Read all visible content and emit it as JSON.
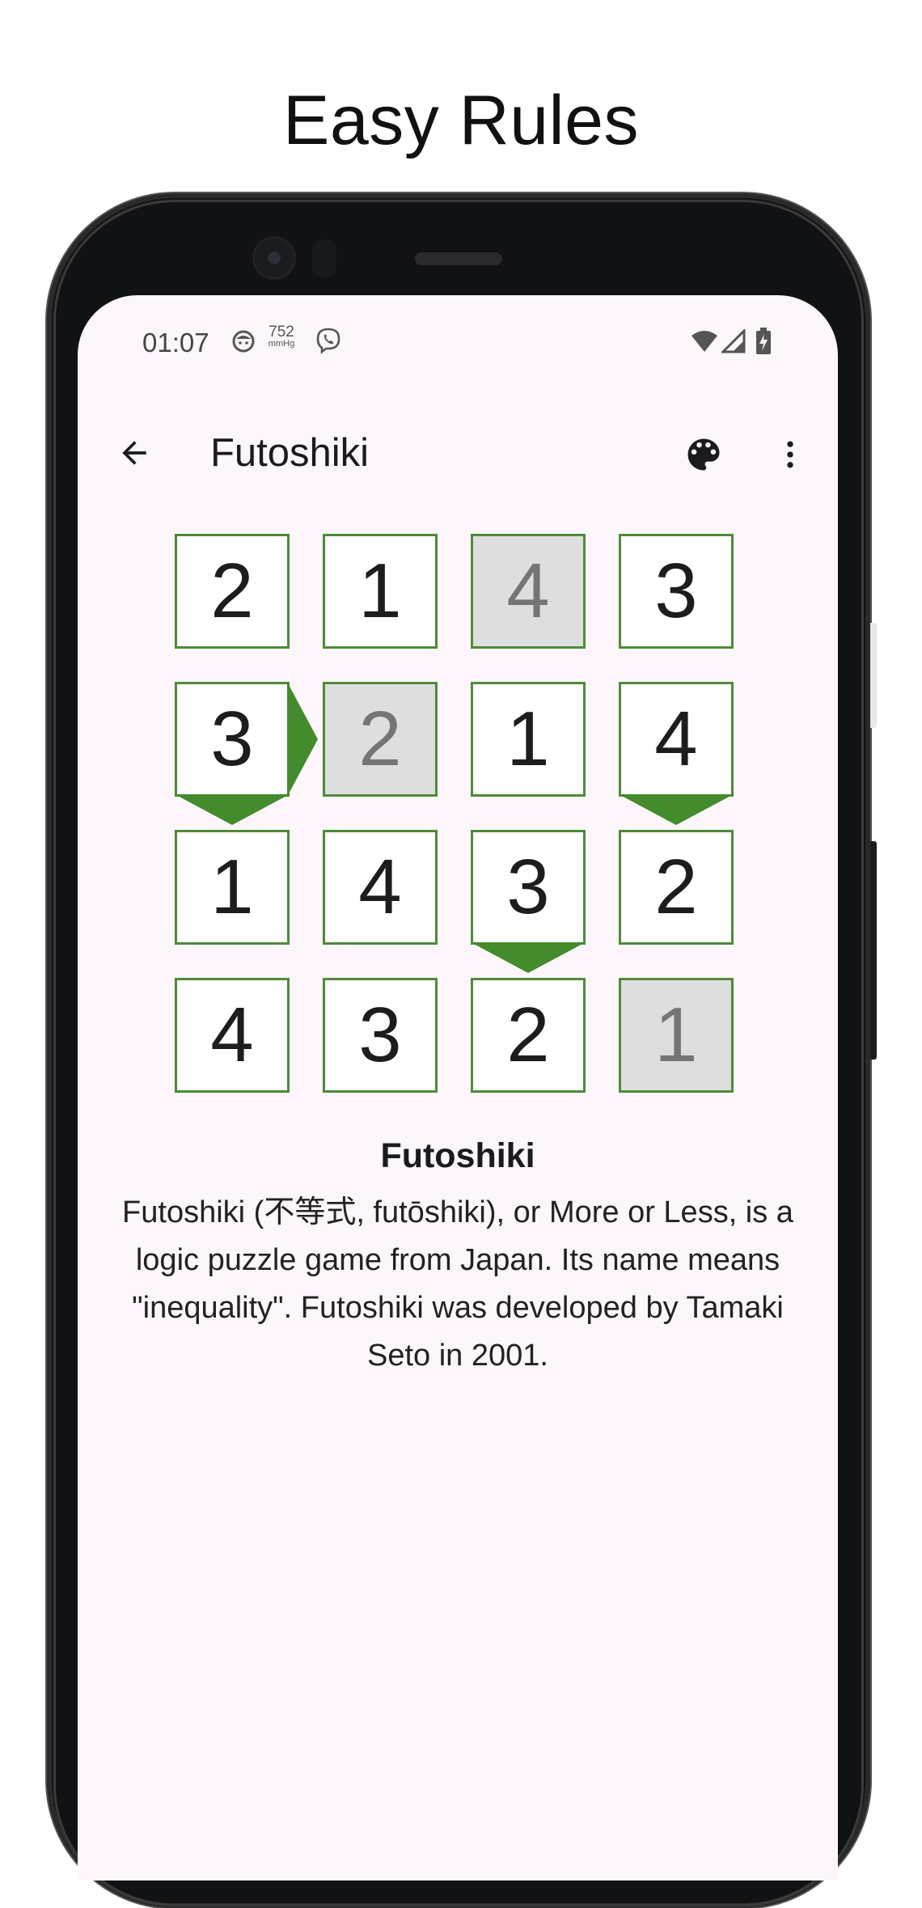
{
  "headline": "Easy Rules",
  "status_bar": {
    "time": "01:07",
    "pressure_value": "752",
    "pressure_unit": "mmHg",
    "icons": [
      "face-icon",
      "viber-icon",
      "wifi-icon",
      "signal-icon",
      "battery-charging-icon"
    ]
  },
  "app_bar": {
    "back_icon": "arrow-back-icon",
    "title": "Futoshiki",
    "palette_icon": "palette-icon",
    "more_icon": "more-vert-icon"
  },
  "puzzle": {
    "rows": [
      [
        "2",
        "1",
        "4",
        "3"
      ],
      [
        "3",
        "2",
        "1",
        "4"
      ],
      [
        "1",
        "4",
        "3",
        "2"
      ],
      [
        "4",
        "3",
        "2",
        "1"
      ]
    ],
    "given_cells": [
      [
        0,
        2
      ],
      [
        1,
        1
      ],
      [
        3,
        3
      ]
    ],
    "inequalities": [
      {
        "row": 1,
        "col": 0,
        "direction": "right",
        "meaning": "cell greater than right neighbour"
      },
      {
        "row": 1,
        "col": 0,
        "direction": "down",
        "meaning": "cell greater than cell below"
      },
      {
        "row": 1,
        "col": 3,
        "direction": "down",
        "meaning": "cell greater than cell below"
      },
      {
        "row": 2,
        "col": 2,
        "direction": "down",
        "meaning": "cell greater than cell below"
      }
    ],
    "colors": {
      "border": "#4e8b3a",
      "inequality": "#438b2c",
      "given_background": "#dedede",
      "given_text": "#757575"
    }
  },
  "rules": {
    "title": "Futoshiki",
    "body": "Futoshiki (不等式, futōshiki), or More or Less, is a logic puzzle game from Japan. Its name means \"inequality\". Futoshiki was developed by Tamaki Seto in 2001."
  },
  "theme": {
    "screen_background": "#fdf6fb"
  }
}
